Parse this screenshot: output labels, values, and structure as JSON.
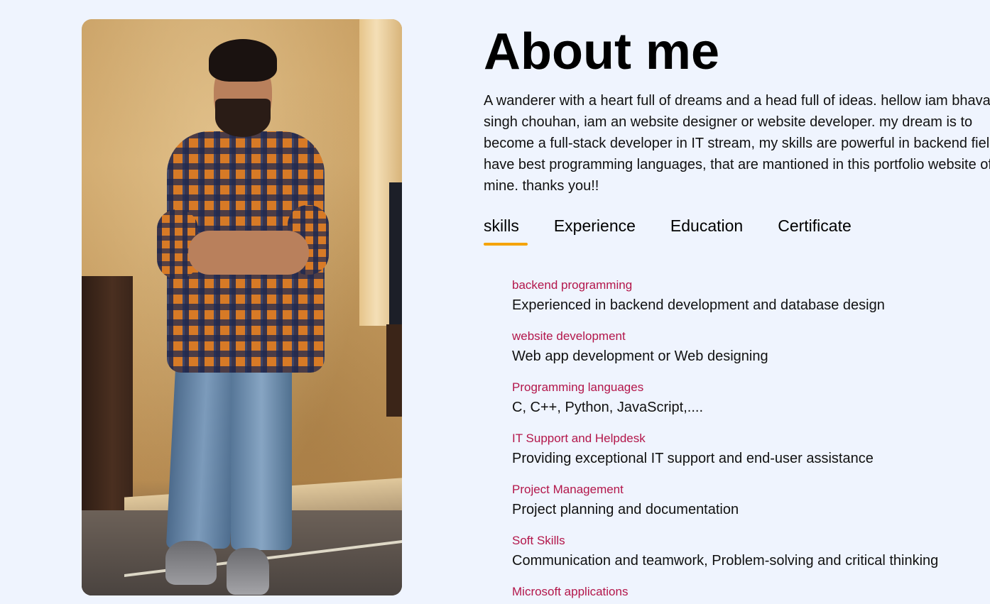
{
  "profile": {
    "photo_alt": "profile photo"
  },
  "about": {
    "title": "About me",
    "intro": "A wanderer with a heart full of dreams and a head full of ideas. hellow iam bhavani singh chouhan, iam an website designer or website developer. my dream is to become a full-stack developer in IT stream, my skills are powerful in backend field. i have best programming languages, that are mantioned in this portfolio website of mine. thanks you!!"
  },
  "tabs": [
    {
      "label": "skills",
      "active": true
    },
    {
      "label": "Experience",
      "active": false
    },
    {
      "label": "Education",
      "active": false
    },
    {
      "label": "Certificate",
      "active": false
    }
  ],
  "skills": [
    {
      "name": "backend programming",
      "desc": "Experienced in backend development and database design"
    },
    {
      "name": "website development",
      "desc": "Web app development or Web designing"
    },
    {
      "name": "Programming languages",
      "desc": "C, C++, Python, JavaScript,...."
    },
    {
      "name": "IT Support and Helpdesk",
      "desc": "Providing exceptional IT support and end-user assistance"
    },
    {
      "name": "Project Management",
      "desc": "Project planning and documentation"
    },
    {
      "name": "Soft Skills",
      "desc": "Communication and teamwork, Problem-solving and critical thinking"
    },
    {
      "name": "Microsoft applications",
      "desc": ""
    }
  ],
  "colors": {
    "background": "#eff4fe",
    "accent_underline": "#f5a300",
    "skill_name": "#b3164a"
  }
}
